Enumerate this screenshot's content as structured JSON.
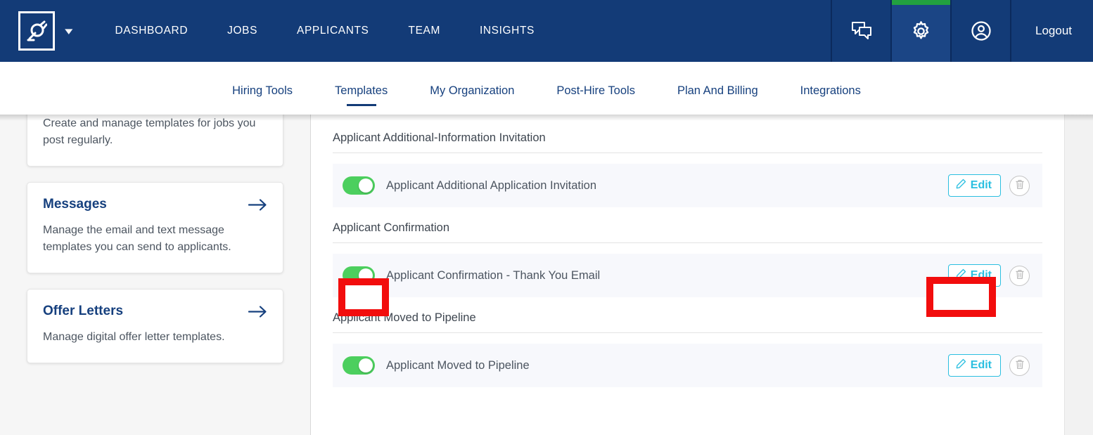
{
  "header": {
    "logo_icon": "plug-logo-icon",
    "logo_caret_icon": "chevron-down-icon",
    "nav": [
      {
        "label": "DASHBOARD",
        "name": "nav-dashboard"
      },
      {
        "label": "JOBS",
        "name": "nav-jobs"
      },
      {
        "label": "APPLICANTS",
        "name": "nav-applicants"
      },
      {
        "label": "TEAM",
        "name": "nav-team"
      },
      {
        "label": "INSIGHTS",
        "name": "nav-insights"
      }
    ],
    "icon_tabs": [
      {
        "icon": "chat-bubbles-icon",
        "active": false
      },
      {
        "icon": "gear-icon",
        "active": true
      },
      {
        "icon": "user-circle-icon",
        "active": false
      }
    ],
    "logout_label": "Logout",
    "background_color": "#133B77",
    "active_tab_accent": "#22a13f"
  },
  "subnav": {
    "items": [
      {
        "label": "Hiring Tools",
        "active": false
      },
      {
        "label": "Templates",
        "active": true
      },
      {
        "label": "My Organization",
        "active": false
      },
      {
        "label": "Post-Hire Tools",
        "active": false
      },
      {
        "label": "Plan And Billing",
        "active": false
      },
      {
        "label": "Integrations",
        "active": false
      }
    ],
    "link_color": "#16407e"
  },
  "sidebar": {
    "cards": [
      {
        "title": "",
        "desc": "Create and manage templates for jobs you post regularly.",
        "clipped": true,
        "arrow_icon": "arrow-right-icon"
      },
      {
        "title": "Messages",
        "desc": "Manage the email and text message templates you can send to applicants.",
        "clipped": false,
        "arrow_icon": "arrow-right-icon"
      },
      {
        "title": "Offer Letters",
        "desc": "Manage digital offer letter templates.",
        "clipped": false,
        "arrow_icon": "arrow-right-icon"
      }
    ]
  },
  "main": {
    "sections": [
      {
        "label": "Applicant Additional-Information Invitation",
        "rows": [
          {
            "name": "Applicant Additional Application Invitation",
            "enabled": true,
            "edit_label": "Edit",
            "edit_icon": "pencil-icon",
            "delete_icon": "trash-icon",
            "highlighted": false
          }
        ]
      },
      {
        "label": "Applicant Confirmation",
        "rows": [
          {
            "name": "Applicant Confirmation - Thank You Email",
            "enabled": true,
            "edit_label": "Edit",
            "edit_icon": "pencil-icon",
            "delete_icon": "trash-icon",
            "highlighted": true
          }
        ]
      },
      {
        "label": "Applicant Moved to Pipeline",
        "rows": [
          {
            "name": "Applicant Moved to Pipeline",
            "enabled": true,
            "edit_label": "Edit",
            "edit_icon": "pencil-icon",
            "delete_icon": "trash-icon",
            "highlighted": false
          }
        ]
      }
    ],
    "toggle_on_color": "#4ccf5e",
    "edit_accent_color": "#2bbfe0",
    "highlight_color": "#f20d0d"
  }
}
